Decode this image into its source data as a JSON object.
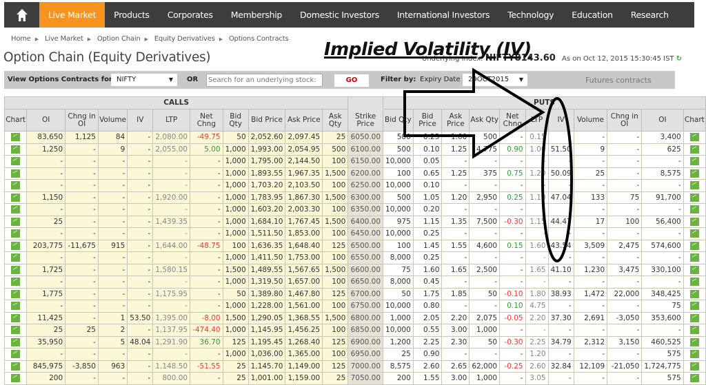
{
  "nav": {
    "items": [
      "Live Market",
      "Products",
      "Corporates",
      "Membership",
      "Domestic Investors",
      "International Investors",
      "Technology",
      "Education",
      "Research"
    ],
    "active": "Live Market",
    "accent": "#f7931e"
  },
  "breadcrumb": [
    "Home",
    "Live Market",
    "Option Chain",
    "Equity Derivatives",
    "Options Contracts"
  ],
  "page_title": "Option Chain (Equity Derivatives)",
  "underlying": {
    "label": "Underlying Index:",
    "symbol": "NIFTY",
    "value": "8143.60",
    "timestamp": "As on Oct 12, 2015 15:30:45 IST"
  },
  "filter": {
    "view_label": "View Options Contracts for:",
    "symbol": "NIFTY",
    "or": "OR",
    "search_placeholder": "Search for an underlying stock:",
    "go": "GO",
    "filter_label": "Filter by:",
    "expiry_label": "Expiry Date",
    "expiry_value": "29OCT2015",
    "futures": "Futures contracts"
  },
  "annotation": {
    "text": "Implied Volatility (IV)"
  },
  "table": {
    "calls_label": "CALLS",
    "puts_label": "PUTS",
    "headers": [
      "Chart",
      "OI",
      "Chng in OI",
      "Volume",
      "IV",
      "LTP",
      "Net Chng",
      "Bid Qty",
      "Bid Price",
      "Ask Price",
      "Ask Qty",
      "Strike Price",
      "Bid Qty",
      "Bid Price",
      "Ask Price",
      "Ask Qty",
      "Net Chng",
      "LTP",
      "IV",
      "Volume",
      "Chng in OI",
      "OI",
      "Chart"
    ],
    "rows": [
      {
        "calls": [
          "83,650",
          "1,125",
          "84",
          "-",
          "2,080.00",
          "-49.75",
          "50",
          "2,052.60",
          "2,097.45",
          "25"
        ],
        "strike": "6050.00",
        "puts": [
          "500",
          "0.25",
          "1.00",
          "500",
          "-",
          "0.15",
          "-",
          "-",
          "-",
          "3,400"
        ]
      },
      {
        "calls": [
          "1,250",
          "-",
          "9",
          "-",
          "2,055.00",
          "5.00",
          "1,000",
          "1,993.00",
          "2,054.95",
          "500"
        ],
        "strike": "6100.00",
        "puts": [
          "500",
          "0.10",
          "1.25",
          "4,775",
          "0.90",
          "1.00",
          "51.50",
          "9",
          "-",
          "625"
        ]
      },
      {
        "calls": [
          "-",
          "-",
          "-",
          "-",
          "-",
          "-",
          "1,000",
          "1,795.00",
          "2,144.50",
          "100"
        ],
        "strike": "6150.00",
        "puts": [
          "10,000",
          "0.05",
          "-",
          "-",
          "-",
          "-",
          "-",
          "-",
          "-",
          "-"
        ]
      },
      {
        "calls": [
          "-",
          "-",
          "-",
          "-",
          "-",
          "-",
          "1,000",
          "1,893.55",
          "1,967.35",
          "1,500"
        ],
        "strike": "6200.00",
        "puts": [
          "100",
          "0.65",
          "1.25",
          "375",
          "0.75",
          "1.20",
          "50.09",
          "25",
          "-",
          "8,575"
        ]
      },
      {
        "calls": [
          "-",
          "-",
          "-",
          "-",
          "-",
          "-",
          "1,000",
          "1,703.20",
          "2,103.50",
          "100"
        ],
        "strike": "6250.00",
        "puts": [
          "10,000",
          "0.10",
          "-",
          "-",
          "-",
          "-",
          "-",
          "-",
          "-",
          "-"
        ]
      },
      {
        "calls": [
          "1,150",
          "-",
          "-",
          "-",
          "1,920.00",
          "-",
          "1,000",
          "1,783.95",
          "1,867.30",
          "1,500"
        ],
        "strike": "6300.00",
        "puts": [
          "500",
          "1.05",
          "1.20",
          "2,950",
          "0.25",
          "1.10",
          "47.04",
          "133",
          "75",
          "91,700"
        ]
      },
      {
        "calls": [
          "-",
          "-",
          "-",
          "-",
          "-",
          "-",
          "1,000",
          "1,603.20",
          "2,003.30",
          "100"
        ],
        "strike": "6350.00",
        "puts": [
          "10,000",
          "0.20",
          "-",
          "-",
          "-",
          "-",
          "-",
          "-",
          "-",
          "-"
        ]
      },
      {
        "calls": [
          "25",
          "-",
          "-",
          "-",
          "1,439.35",
          "-",
          "1,000",
          "1,684.10",
          "1,767.45",
          "1,500"
        ],
        "strike": "6400.00",
        "puts": [
          "975",
          "1.15",
          "1.35",
          "7,500",
          "-0.30",
          "1.15",
          "44.47",
          "17",
          "100",
          "56,400"
        ]
      },
      {
        "calls": [
          "-",
          "-",
          "-",
          "-",
          "-",
          "-",
          "1,000",
          "1,511.50",
          "1,853.00",
          "100"
        ],
        "strike": "6450.00",
        "puts": [
          "10,000",
          "0.25",
          "-",
          "-",
          "-",
          "-",
          "-",
          "-",
          "-",
          "-"
        ]
      },
      {
        "calls": [
          "203,775",
          "-11,675",
          "915",
          "-",
          "1,644.00",
          "-48.75",
          "100",
          "1,636.35",
          "1,648.40",
          "125"
        ],
        "strike": "6500.00",
        "puts": [
          "100",
          "1.45",
          "1.55",
          "4,600",
          "0.15",
          "1.60",
          "43.54",
          "3,509",
          "2,475",
          "574,600"
        ]
      },
      {
        "calls": [
          "-",
          "-",
          "-",
          "-",
          "-",
          "-",
          "1,000",
          "1,411.50",
          "1,753.00",
          "100"
        ],
        "strike": "6550.00",
        "puts": [
          "8,000",
          "0.25",
          "-",
          "-",
          "-",
          "-",
          "-",
          "-",
          "-",
          "-"
        ]
      },
      {
        "calls": [
          "1,725",
          "-",
          "-",
          "-",
          "1,580.15",
          "-",
          "1,500",
          "1,489.55",
          "1,567.65",
          "1,500"
        ],
        "strike": "6600.00",
        "puts": [
          "75",
          "1.60",
          "1.65",
          "2,500",
          "-",
          "1.65",
          "41.10",
          "1,230",
          "3,475",
          "330,100"
        ]
      },
      {
        "calls": [
          "-",
          "-",
          "-",
          "-",
          "-",
          "-",
          "1,000",
          "1,319.50",
          "1,657.00",
          "100"
        ],
        "strike": "6650.00",
        "puts": [
          "8,000",
          "0.45",
          "-",
          "-",
          "-",
          "-",
          "-",
          "-",
          "-",
          "-"
        ]
      },
      {
        "calls": [
          "1,775",
          "-",
          "-",
          "-",
          "1,175.95",
          "-",
          "50",
          "1,389.80",
          "1,467.80",
          "125"
        ],
        "strike": "6700.00",
        "puts": [
          "50",
          "1.75",
          "1.85",
          "50",
          "-0.10",
          "1.80",
          "38.93",
          "1,472",
          "22,000",
          "348,425"
        ]
      },
      {
        "calls": [
          "-",
          "-",
          "-",
          "-",
          "-",
          "-",
          "1,000",
          "1,228.00",
          "1,561.00",
          "100"
        ],
        "strike": "6750.00",
        "puts": [
          "10,000",
          "0.80",
          "-",
          "-",
          "0.10",
          "4.75",
          "-",
          "-",
          "-",
          "75"
        ]
      },
      {
        "calls": [
          "11,425",
          "-",
          "1",
          "53.50",
          "1,395.00",
          "-8.00",
          "1,500",
          "1,290.05",
          "1,368.55",
          "1,500"
        ],
        "strike": "6800.00",
        "puts": [
          "1,000",
          "2.05",
          "2.20",
          "2,075",
          "-0.05",
          "2.20",
          "37.30",
          "2,691",
          "-3,050",
          "353,600"
        ]
      },
      {
        "calls": [
          "25",
          "25",
          "2",
          "-",
          "1,137.95",
          "-474.40",
          "1,000",
          "1,145.95",
          "1,456.25",
          "100"
        ],
        "strike": "6850.00",
        "puts": [
          "10,000",
          "0.55",
          "3.00",
          "1,000",
          "-",
          "-",
          "-",
          "-",
          "-",
          "-"
        ]
      },
      {
        "calls": [
          "35,950",
          "-",
          "5",
          "48.04",
          "1,291.90",
          "36.70",
          "125",
          "1,195.45",
          "1,268.40",
          "125"
        ],
        "strike": "6900.00",
        "puts": [
          "1,200",
          "2.25",
          "2.30",
          "50",
          "-0.30",
          "2.25",
          "34.79",
          "2,312",
          "3,150",
          "460,525"
        ]
      },
      {
        "calls": [
          "-",
          "-",
          "-",
          "-",
          "-",
          "-",
          "1,000",
          "1,036.00",
          "1,365.00",
          "100"
        ],
        "strike": "6950.00",
        "puts": [
          "25",
          "0.90",
          "-",
          "-",
          "-",
          "1.20",
          "-",
          "-",
          "-",
          "575"
        ]
      },
      {
        "calls": [
          "845,975",
          "-3,850",
          "963",
          "-",
          "1,148.50",
          "-51.55",
          "25",
          "1,145.70",
          "1,149.00",
          "125"
        ],
        "strike": "7000.00",
        "puts": [
          "8,575",
          "2.60",
          "2.65",
          "62,000",
          "-0.25",
          "2.60",
          "32.84",
          "12,109",
          "-21,050",
          "1,724,775"
        ]
      },
      {
        "calls": [
          "200",
          "-",
          "-",
          "-",
          "800.00",
          "-",
          "25",
          "1,001.00",
          "1,159.00",
          "25"
        ],
        "strike": "7050.00",
        "puts": [
          "200",
          "1.55",
          "3.00",
          "1,000",
          "-",
          "3.05",
          "-",
          "-",
          "-",
          "575"
        ]
      }
    ]
  }
}
